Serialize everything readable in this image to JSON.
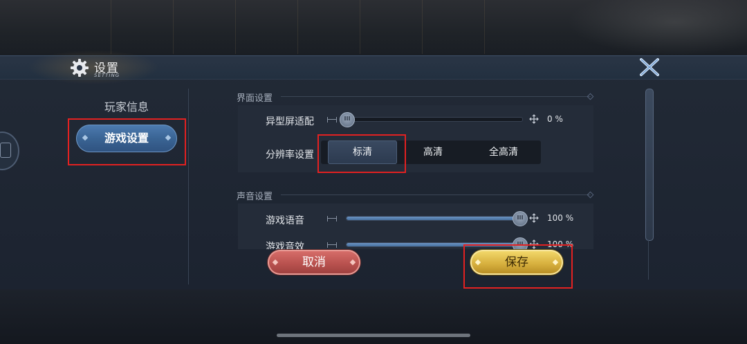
{
  "window": {
    "title": "设置",
    "subtitle": "SETTING"
  },
  "sidebar": {
    "items": [
      {
        "label": "玩家信息",
        "active": false
      },
      {
        "label": "游戏设置",
        "active": true
      }
    ]
  },
  "sections": {
    "interface": {
      "title": "界面设置",
      "notch_adapt": {
        "label": "异型屏适配",
        "value_text": "0 %",
        "value": 0
      },
      "resolution": {
        "label": "分辨率设置",
        "options": [
          "标清",
          "高清",
          "全高清"
        ],
        "selected": "标清"
      }
    },
    "sound": {
      "title": "声音设置",
      "game_voice": {
        "label": "游戏语音",
        "value_text": "100 %",
        "value": 100
      },
      "game_sfx": {
        "label": "游戏音效",
        "value_text": "100 %",
        "value": 100
      }
    }
  },
  "buttons": {
    "cancel": "取消",
    "save": "保存"
  },
  "icons": {
    "settings": "gear-icon",
    "close": "close-x-icon",
    "slider_min": "slider-min-icon",
    "slider_max": "move-arrows-icon"
  },
  "colors": {
    "accent_blue": "#3a6494",
    "cancel_red": "#b9524f",
    "save_gold": "#d8b13f",
    "highlight_red": "#e32121"
  }
}
